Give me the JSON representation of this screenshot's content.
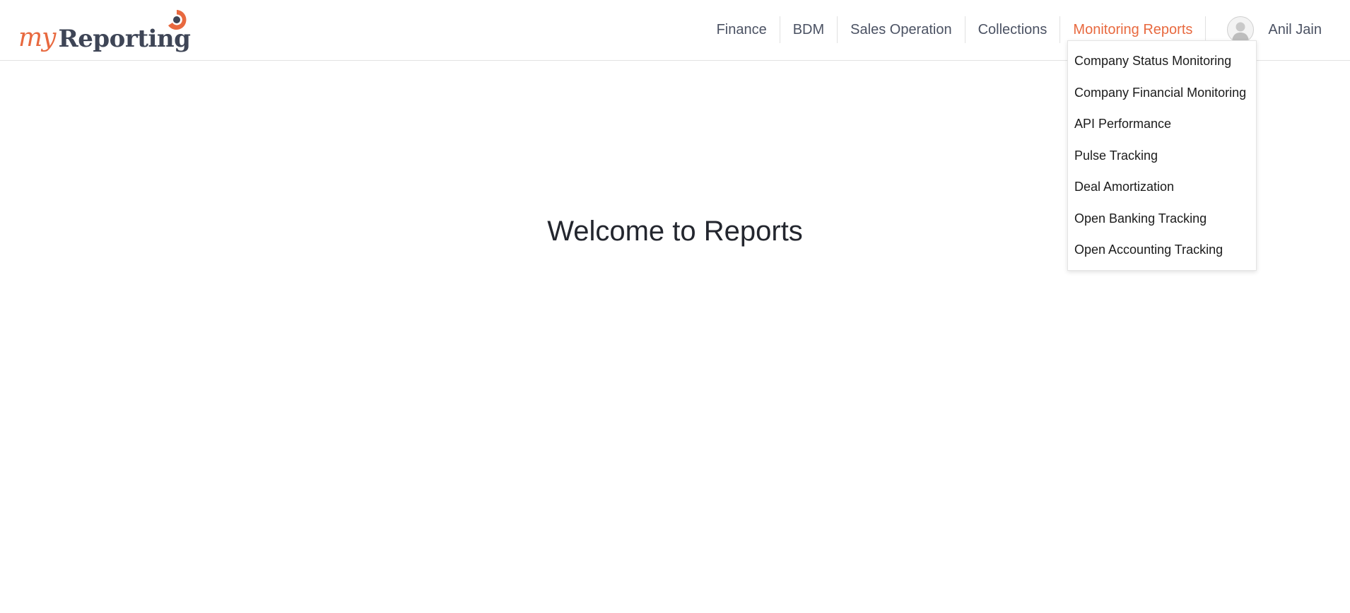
{
  "app": {
    "logo_my": "my",
    "logo_reporting": "Reporting"
  },
  "nav": {
    "items": [
      {
        "label": "Finance"
      },
      {
        "label": "BDM"
      },
      {
        "label": "Sales Operation"
      },
      {
        "label": "Collections"
      },
      {
        "label": "Monitoring Reports",
        "active": true
      }
    ]
  },
  "user": {
    "name": "Anil Jain",
    "avatar_icon": "user-avatar-icon"
  },
  "dropdown": {
    "items": [
      {
        "label": "Company Status Monitoring"
      },
      {
        "label": "Company Financial Monitoring"
      },
      {
        "label": "API Performance"
      },
      {
        "label": "Pulse Tracking"
      },
      {
        "label": "Deal Amortization"
      },
      {
        "label": "Open Banking Tracking"
      },
      {
        "label": "Open Accounting Tracking"
      }
    ]
  },
  "main": {
    "heading": "Welcome to Reports"
  },
  "colors": {
    "accent": "#e8693f",
    "text": "#4b5263",
    "brand_dark": "#3e4556"
  }
}
